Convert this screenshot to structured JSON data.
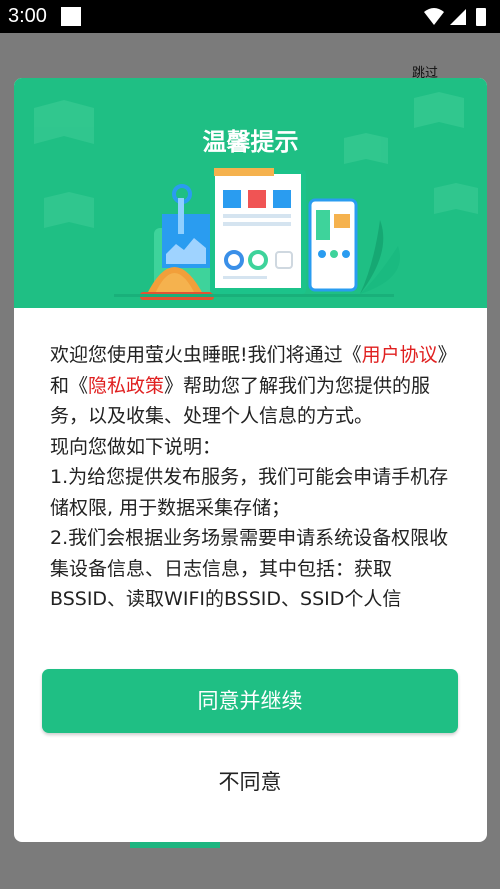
{
  "status_bar": {
    "time": "3:00"
  },
  "skip_label": "跳过",
  "dialog": {
    "title": "温馨提示",
    "body": {
      "p1_a": "欢迎您使用萤火虫睡眠!我们将通过《",
      "p1_link1": "用户协议",
      "p1_b": "》和《",
      "p1_link2": "隐私政策",
      "p1_c": "》帮助您了解我们为您提供的服务，以及收集、处理个人信息的方式。",
      "p2": "现向您做如下说明：",
      "p3": "1.为给您提供发布服务，我们可能会申请手机存储权限, 用于数据采集存储；",
      "p4": "2.我们会根据业务场景需要申请系统设备权限收集设备信息、日志信息，其中包括：获取BSSID、读取WIFI的BSSID、SSID个人信"
    },
    "agree_button": "同意并继续",
    "disagree_button": "不同意"
  },
  "colors": {
    "accent": "#1fbf84",
    "link": "#e02020"
  }
}
